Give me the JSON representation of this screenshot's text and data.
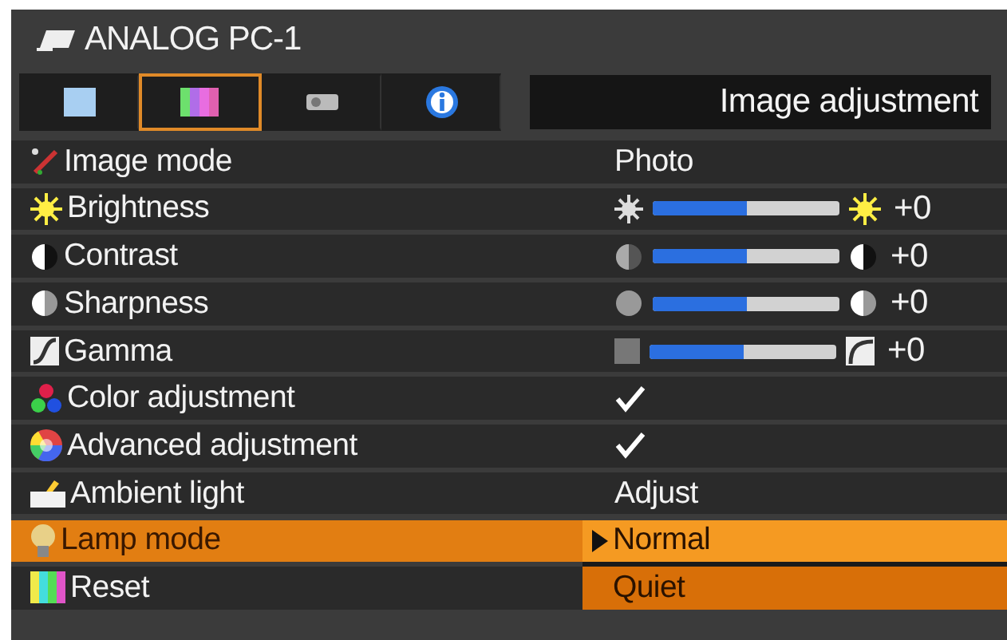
{
  "source": {
    "title": "ANALOG PC-1"
  },
  "tabs": [
    {
      "selected": false
    },
    {
      "selected": true
    },
    {
      "selected": false
    },
    {
      "selected": false
    }
  ],
  "section_title": "Image adjustment",
  "rows": [
    {
      "kind": "value",
      "label": "Image mode",
      "value": "Photo",
      "selected": false
    },
    {
      "kind": "slider",
      "label": "Brightness",
      "level": 0.5,
      "reading": "+0",
      "selected": false
    },
    {
      "kind": "slider",
      "label": "Contrast",
      "level": 0.5,
      "reading": "+0",
      "selected": false
    },
    {
      "kind": "slider",
      "label": "Sharpness",
      "level": 0.5,
      "reading": "+0",
      "selected": false
    },
    {
      "kind": "slider",
      "label": "Gamma",
      "level": 0.5,
      "reading": "+0",
      "selected": false
    },
    {
      "kind": "check",
      "label": "Color adjustment",
      "checked": true,
      "selected": false
    },
    {
      "kind": "check",
      "label": "Advanced adjustment",
      "checked": true,
      "selected": false
    },
    {
      "kind": "value",
      "label": "Ambient light",
      "value": "Adjust",
      "selected": false
    },
    {
      "kind": "select",
      "label": "Lamp mode",
      "selected": true,
      "options": [
        {
          "label": "Normal",
          "selected": true
        },
        {
          "label": "Quiet",
          "selected": false
        }
      ]
    },
    {
      "kind": "covered",
      "label": "Reset",
      "selected": false
    }
  ]
}
